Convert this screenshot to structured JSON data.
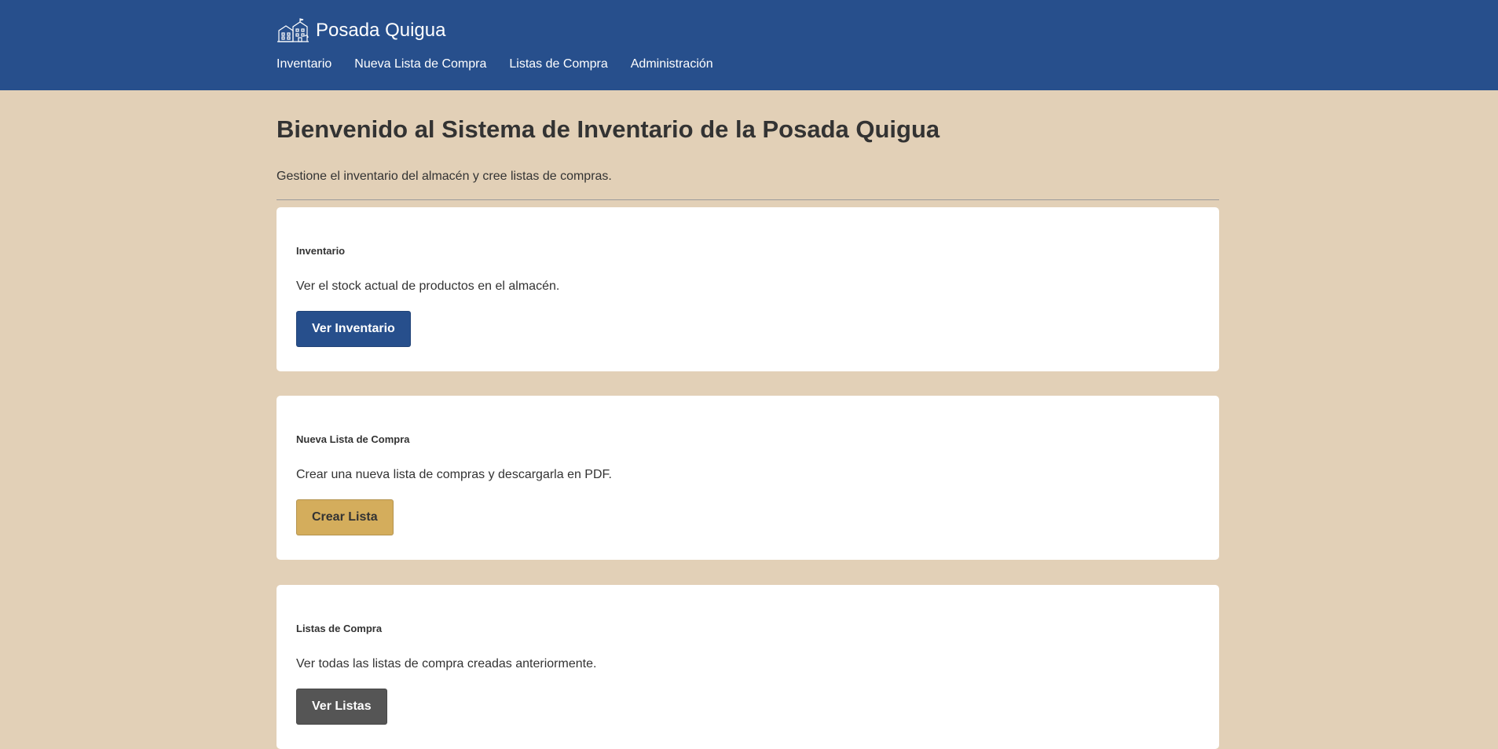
{
  "header": {
    "brand_name": "Posada Quigua",
    "logo_icon": "hotel-building-icon",
    "colors": {
      "background": "#274f8c",
      "text": "#ffffff"
    }
  },
  "nav": {
    "items": [
      {
        "label": "Inventario"
      },
      {
        "label": "Nueva Lista de Compra"
      },
      {
        "label": "Listas de Compra"
      },
      {
        "label": "Administración"
      }
    ]
  },
  "main": {
    "title": "Bienvenido al Sistema de Inventario de la Posada Quigua",
    "subtitle": "Gestione el inventario del almacén y cree listas de compras.",
    "cards": [
      {
        "title": "Inventario",
        "description": "Ver el stock actual de productos en el almacén.",
        "button_label": "Ver Inventario",
        "button_color": "#274f8c"
      },
      {
        "title": "Nueva Lista de Compra",
        "description": "Crear una nueva lista de compras y descargarla en PDF.",
        "button_label": "Crear Lista",
        "button_color": "#d4ad5c"
      },
      {
        "title": "Listas de Compra",
        "description": "Ver todas las listas de compra creadas anteriormente.",
        "button_label": "Ver Listas",
        "button_color": "#555555"
      }
    ]
  },
  "colors": {
    "page_background": "#e2d0b7",
    "card_background": "#ffffff",
    "text": "#333333"
  }
}
